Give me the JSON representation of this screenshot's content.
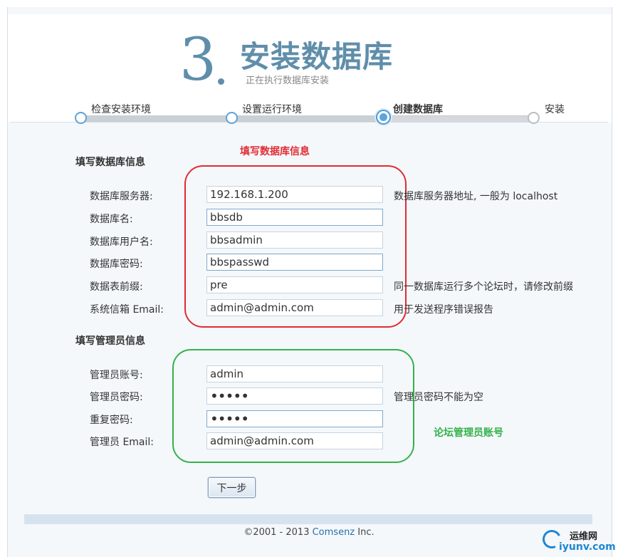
{
  "header": {
    "step_number": "3",
    "title": "安装数据库",
    "subtitle": "正在执行数据库安装"
  },
  "steps": [
    {
      "label": "检查安装环境",
      "state": "done"
    },
    {
      "label": "设置运行环境",
      "state": "done"
    },
    {
      "label": "创建数据库",
      "state": "current"
    },
    {
      "label": "安装",
      "state": "pending"
    }
  ],
  "db_section": {
    "title": "填写数据库信息",
    "annotation": "填写数据库信息",
    "fields": [
      {
        "label": "数据库服务器:",
        "value": "192.168.1.200",
        "hint": "数据库服务器地址, 一般为 localhost"
      },
      {
        "label": "数据库名:",
        "value": "bbsdb",
        "hint": ""
      },
      {
        "label": "数据库用户名:",
        "value": "bbsadmin",
        "hint": ""
      },
      {
        "label": "数据库密码:",
        "value": "bbspasswd",
        "hint": ""
      },
      {
        "label": "数据表前缀:",
        "value": "pre",
        "hint": "同一数据库运行多个论坛时，请修改前缀"
      },
      {
        "label": "系统信箱 Email:",
        "value": "admin@admin.com",
        "hint": "用于发送程序错误报告"
      }
    ]
  },
  "admin_section": {
    "title": "填写管理员信息",
    "annotation": "论坛管理员账号",
    "fields": [
      {
        "label": "管理员账号:",
        "value": "admin",
        "hint": ""
      },
      {
        "label": "管理员密码:",
        "value": "•••••",
        "hint": "管理员密码不能为空"
      },
      {
        "label": "重复密码:",
        "value": "•••••",
        "hint": ""
      },
      {
        "label": "管理员 Email:",
        "value": "admin@admin.com",
        "hint": ""
      }
    ]
  },
  "buttons": {
    "next": "下一步"
  },
  "footer": {
    "prefix": "©2001 - 2013 ",
    "brand": "Comsenz",
    "suffix": " Inc."
  },
  "watermark": {
    "cn": "运维网",
    "en": "iyunv.com"
  },
  "colors": {
    "accent": "#5f8eaa",
    "progress_node": "#5aa7de",
    "annotation_red": "#e12b33",
    "annotation_green": "#34b14a",
    "link": "#2a6fb0"
  }
}
